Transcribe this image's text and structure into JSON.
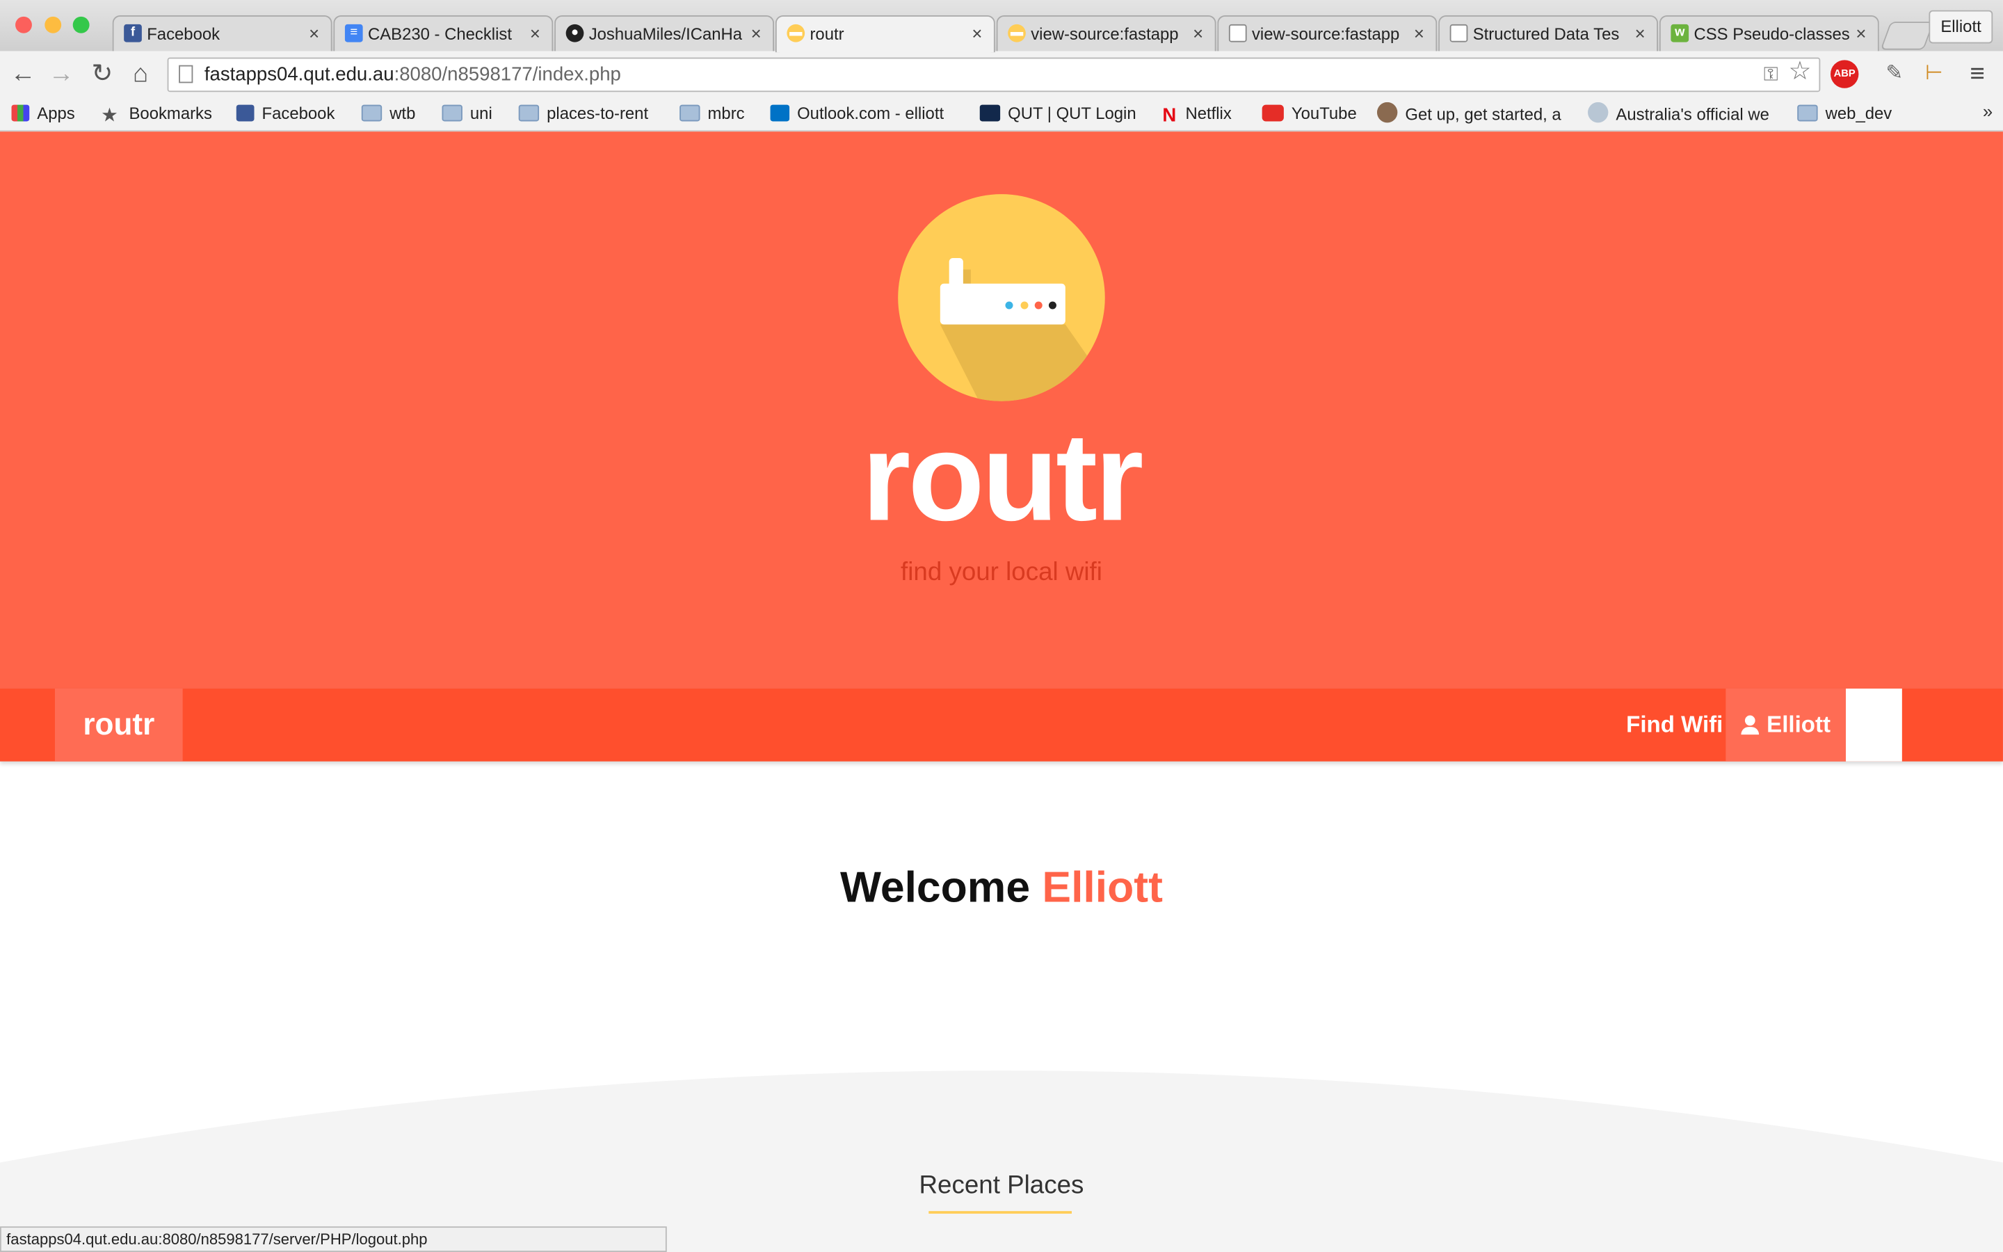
{
  "browser": {
    "tabs": [
      {
        "label": "Facebook",
        "icon": "facebook-icon",
        "color": "#3b5998"
      },
      {
        "label": "CAB230 - Checklist",
        "icon": "docs-icon",
        "color": "#4285f4"
      },
      {
        "label": "JoshuaMiles/ICanHa",
        "icon": "github-icon",
        "color": "#222222"
      },
      {
        "label": "routr",
        "icon": "routr-icon",
        "color": "#ffcd56"
      },
      {
        "label": "view-source:fastapp",
        "icon": "routr-icon",
        "color": "#ffcd56"
      },
      {
        "label": "view-source:fastapp",
        "icon": "page-icon",
        "color": "#888888"
      },
      {
        "label": "Structured Data Tes",
        "icon": "page-icon",
        "color": "#888888"
      },
      {
        "label": "CSS Pseudo-classes",
        "icon": "w3-icon",
        "color": "#6cb33e"
      }
    ],
    "profile_name": "Elliott",
    "url_host": "fastapps04.qut.edu.au",
    "url_rest": ":8080/n8598177/index.php",
    "bookmarks": [
      {
        "label": "Apps",
        "icon": "apps-grid-icon"
      },
      {
        "label": "Bookmarks",
        "icon": "star-icon"
      },
      {
        "label": "Facebook",
        "icon": "facebook-icon"
      },
      {
        "label": "wtb",
        "icon": "folder-icon"
      },
      {
        "label": "uni",
        "icon": "folder-icon"
      },
      {
        "label": "places-to-rent",
        "icon": "folder-icon"
      },
      {
        "label": "mbrc",
        "icon": "folder-icon"
      },
      {
        "label": "Outlook.com - elliott",
        "icon": "outlook-icon"
      },
      {
        "label": "QUT | QUT Login",
        "icon": "qut-icon"
      },
      {
        "label": "Netflix",
        "icon": "netflix-icon"
      },
      {
        "label": "YouTube",
        "icon": "youtube-icon"
      },
      {
        "label": "Get up, get started, a",
        "icon": "avatar-icon"
      },
      {
        "label": "Australia's official we",
        "icon": "globe-icon"
      },
      {
        "label": "web_dev",
        "icon": "folder-icon"
      }
    ],
    "status_url": "fastapps04.qut.edu.au:8080/n8598177/server/PHP/logout.php"
  },
  "page": {
    "hero_title": "routr",
    "tagline": "find your local wifi",
    "nav": {
      "brand": "routr",
      "find_wifi": "Find Wifi",
      "user": "Elliott"
    },
    "welcome_prefix": "Welcome",
    "welcome_name": "Elliott",
    "recent_heading": "Recent Places"
  },
  "colors": {
    "hero_bg": "#ff6449",
    "nav_bg": "#ff4f2d",
    "accent_yellow": "#ffcd56",
    "tagline": "#d93a20"
  }
}
